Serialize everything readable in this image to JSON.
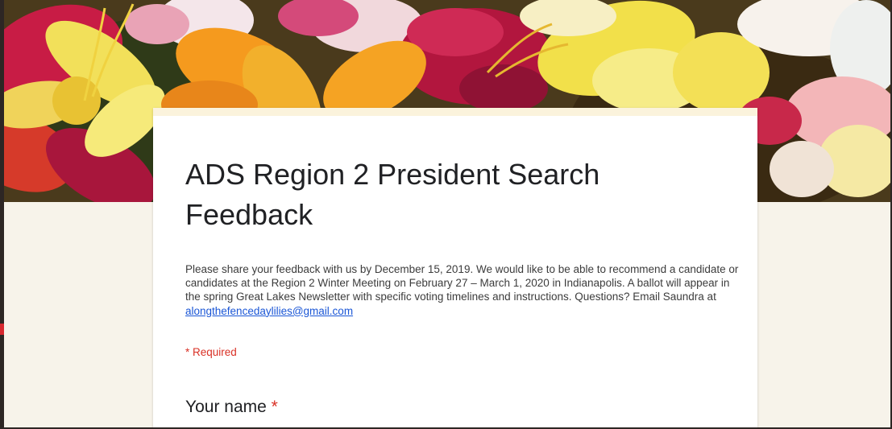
{
  "form": {
    "title": "ADS Region 2 President Search Feedback",
    "description": "Please share your feedback with us by December 15, 2019.  We would like to be able to recommend a candidate or candidates at the Region 2 Winter Meeting on February 27 – March 1, 2020 in Indianapolis. A ballot will appear in the spring Great Lakes Newsletter with specific voting timelines and instructions.  Questions? Email Saundra at ",
    "email_link": "alongthefencedaylilies@gmail.com",
    "required_note": "* Required",
    "questions": [
      {
        "label": "Your name",
        "required_mark": "*"
      }
    ]
  },
  "colors": {
    "page_background": "#f7f3ea",
    "card_background": "#ffffff",
    "required_red": "#d93025",
    "link_blue": "#1a56d6"
  },
  "banner": {
    "subject": "daylily flowers"
  }
}
